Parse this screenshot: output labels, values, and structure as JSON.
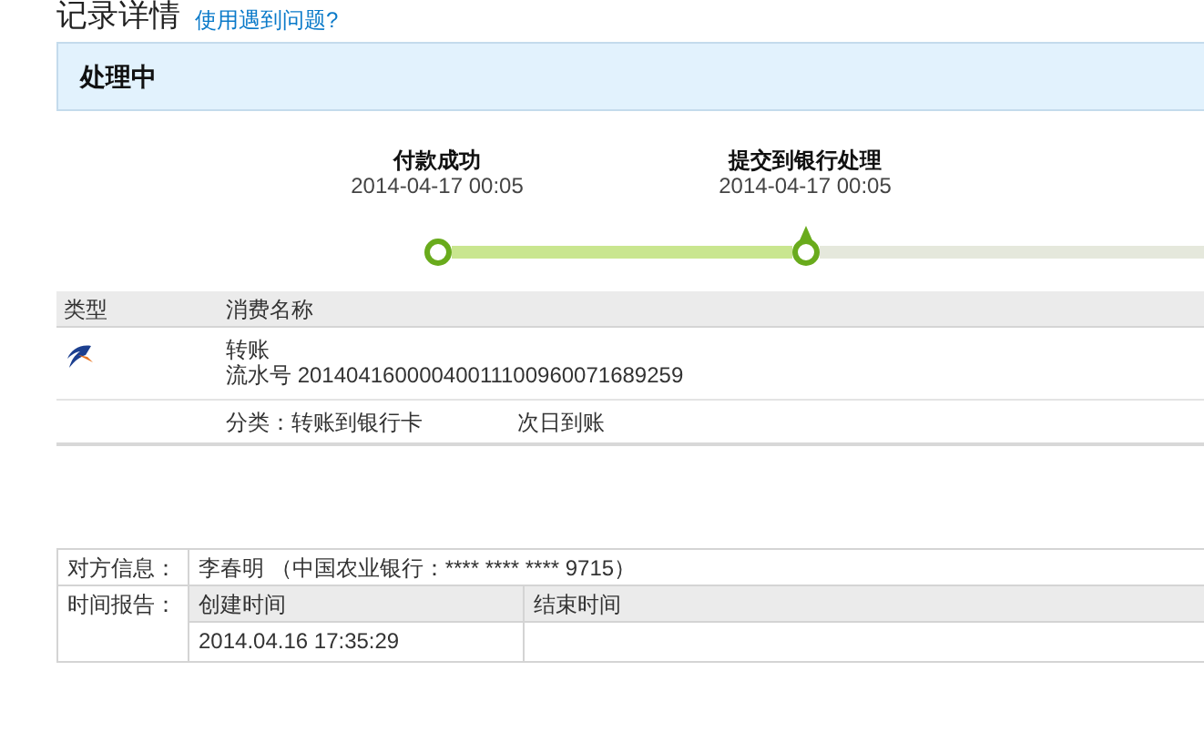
{
  "header": {
    "title": "记录详情",
    "help_link": "使用遇到问题?"
  },
  "status": {
    "text": "处理中"
  },
  "steps": [
    {
      "label": "付款成功",
      "time": "2014-04-17 00:05",
      "reached": true,
      "current": false
    },
    {
      "label": "提交到银行处理",
      "time": "2014-04-17 00:05",
      "reached": true,
      "current": true
    }
  ],
  "table": {
    "columns": [
      "类型",
      "消费名称"
    ],
    "record": {
      "name": "转账",
      "serial": "流水号 20140416000040011100960071689259",
      "category": "分类：转账到银行卡",
      "arrival": "次日到账"
    }
  },
  "info": {
    "party_label": "对方信息：",
    "party_value": "李春明 （中国农业银行：**** **** **** 9715）",
    "time_label": "时间报告：",
    "time_columns": [
      "创建时间",
      "结束时间"
    ],
    "time_values": [
      "2014.04.16 17:35:29"
    ]
  }
}
